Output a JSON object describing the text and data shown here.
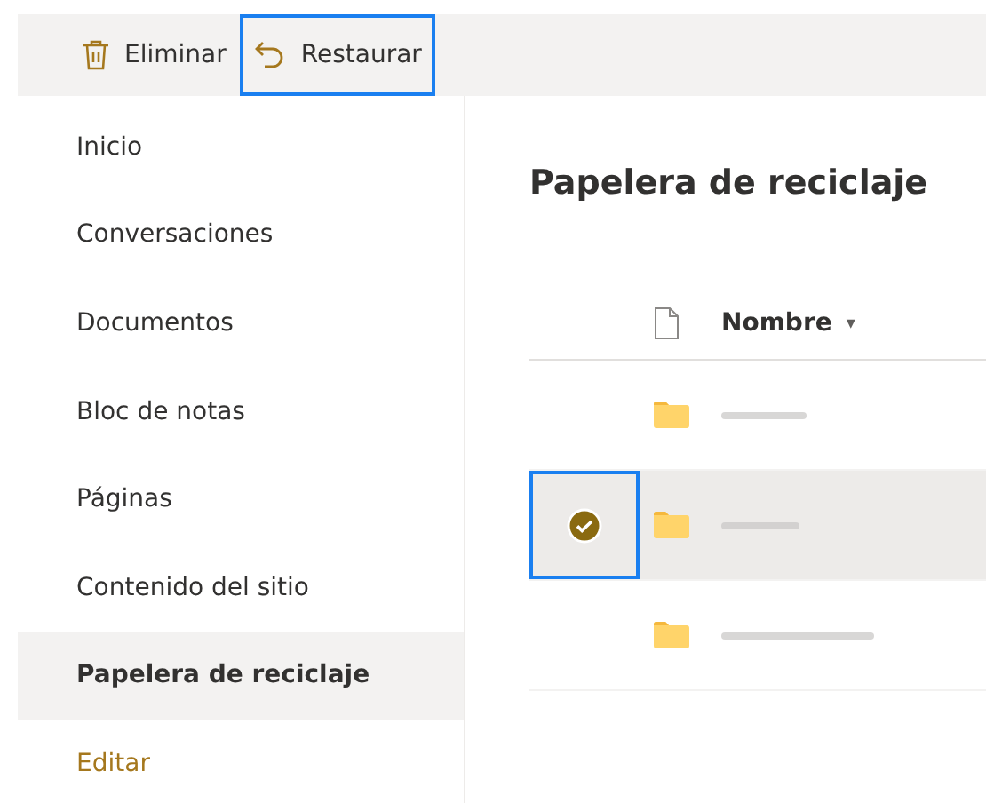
{
  "toolbar": {
    "buttons": [
      {
        "kind": "delete",
        "label": "Eliminar",
        "highlighted": false
      },
      {
        "kind": "restore",
        "label": "Restaurar",
        "highlighted": true
      }
    ]
  },
  "sidebar": {
    "items": [
      {
        "label": "Inicio",
        "selected": false
      },
      {
        "label": "Conversaciones",
        "selected": false
      },
      {
        "label": "Documentos",
        "selected": false
      },
      {
        "label": "Bloc de notas",
        "selected": false
      },
      {
        "label": "Páginas",
        "selected": false
      },
      {
        "label": "Contenido del sitio",
        "selected": false
      },
      {
        "label": "Papelera de reciclaje",
        "selected": true
      }
    ],
    "edit_link": "Editar"
  },
  "main": {
    "title": "Papelera de reciclaje",
    "table": {
      "columns": [
        {
          "label": "Nombre",
          "sort": "▾"
        }
      ],
      "rows": [
        {
          "selected": false,
          "highlighted": false
        },
        {
          "selected": true,
          "highlighted": true
        },
        {
          "selected": false,
          "highlighted": false
        }
      ]
    }
  }
}
